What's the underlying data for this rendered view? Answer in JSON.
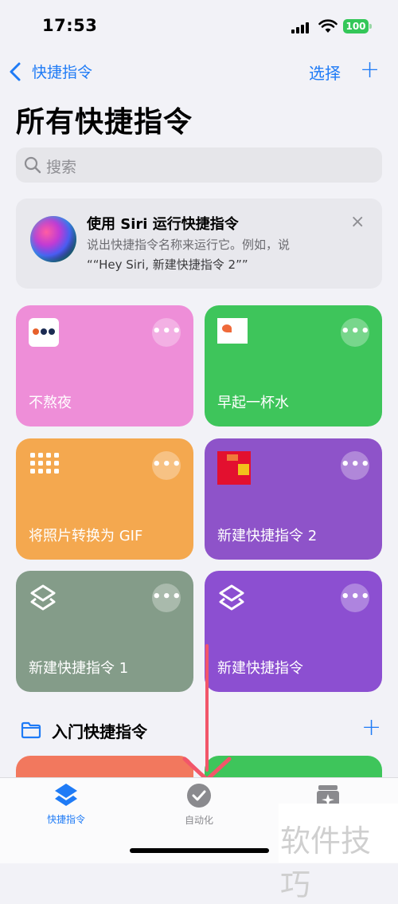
{
  "status": {
    "time": "17:53",
    "battery": "100"
  },
  "nav": {
    "back_label": "快捷指令",
    "select_label": "选择",
    "add_label": "+"
  },
  "title": "所有快捷指令",
  "search": {
    "placeholder": "搜索"
  },
  "siri_card": {
    "title": "使用 Siri 运行快捷指令",
    "line1": "说出快捷指令名称来运行它。例如，说",
    "line2": "““Hey Siri, 新建快捷指令 2””",
    "close": "×"
  },
  "shortcuts": [
    {
      "label": "不熬夜",
      "color": "#ee8ed8"
    },
    {
      "label": "早起一杯水",
      "color": "#3ec55b"
    },
    {
      "label": "将照片转换为 GIF",
      "color": "#f4a84f"
    },
    {
      "label": "新建快捷指令 2",
      "color": "#8e53c9"
    },
    {
      "label": "新建快捷指令 1",
      "color": "#849c89"
    },
    {
      "label": "新建快捷指令",
      "color": "#8c4fd1"
    }
  ],
  "section": {
    "title": "入门快捷指令",
    "add_label": "+"
  },
  "tabs": [
    {
      "label": "快捷指令",
      "active": true
    },
    {
      "label": "自动化",
      "active": false
    },
    {
      "label": "",
      "active": false
    }
  ],
  "watermark": "软件技巧"
}
